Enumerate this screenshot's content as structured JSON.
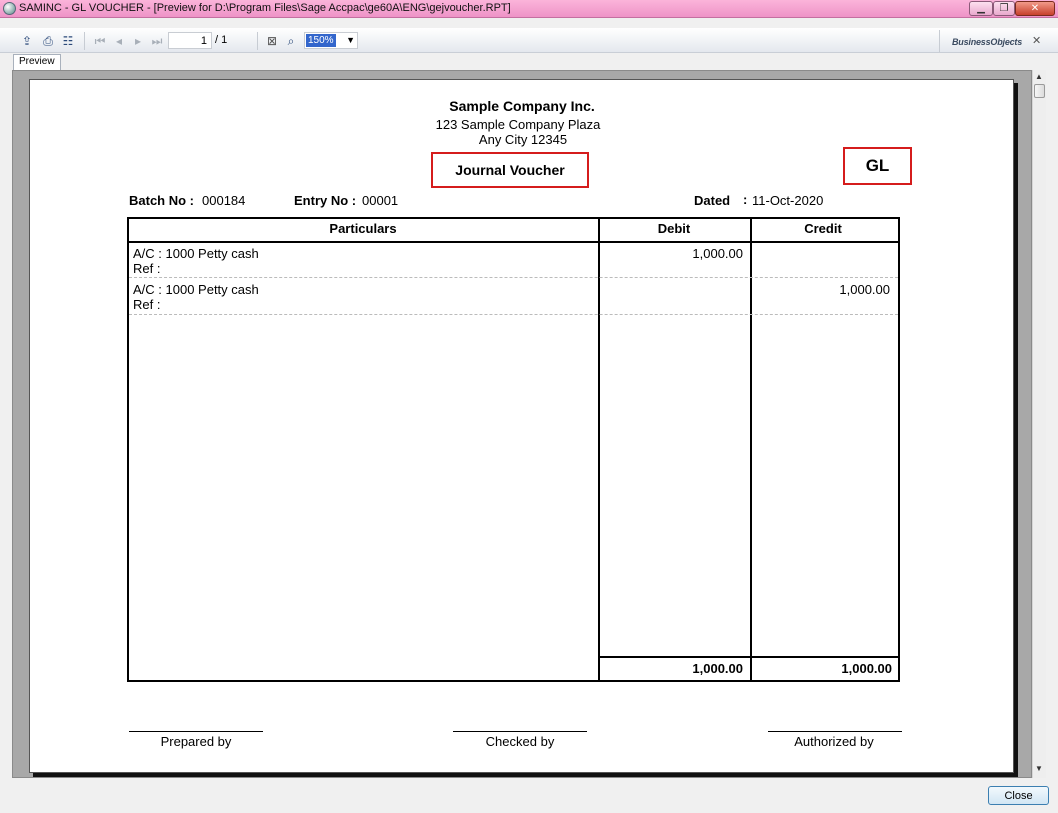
{
  "window": {
    "title": "SAMINC - GL VOUCHER - [Preview for D:\\Program Files\\Sage Accpac\\ge60A\\ENG\\gejvoucher.RPT]",
    "minimize_icon": "minimize-icon",
    "maximize_icon": "maximize-icon",
    "close_icon": "close-icon"
  },
  "toolbar": {
    "page_current": "1",
    "page_total": "/ 1",
    "zoom": "150%",
    "brand": "BusinessObjects",
    "icons": [
      "export-icon",
      "print-icon",
      "group-tree-icon",
      "first-page-icon",
      "prev-page-icon",
      "next-page-icon",
      "last-page-icon",
      "stop-icon",
      "find-icon",
      "dropdown-arrow-icon",
      "close-icon"
    ]
  },
  "tabs": [
    {
      "label": "Preview"
    }
  ],
  "report": {
    "company_name": "Sample Company Inc.",
    "address_line1": "123 Sample Company Plaza",
    "address_line2": "Any City 12345",
    "doc_title": "Journal Voucher",
    "ledger_code": "GL",
    "batch_label": "Batch No :",
    "batch_no": "000184",
    "entry_label": "Entry No :",
    "entry_no": "00001",
    "dated_label": "Dated",
    "dated_sep": ":",
    "date": "11-Oct-2020",
    "columns": {
      "particulars": "Particulars",
      "debit": "Debit",
      "credit": "Credit"
    },
    "rows": [
      {
        "account": "A/C : 1000 Petty cash",
        "ref": "Ref :",
        "debit": "1,000.00",
        "credit": ""
      },
      {
        "account": "A/C : 1000 Petty cash",
        "ref": "Ref :",
        "debit": "",
        "credit": "1,000.00"
      }
    ],
    "totals": {
      "debit": "1,000.00",
      "credit": "1,000.00"
    },
    "signatures": {
      "prepared": "Prepared by",
      "checked": "Checked by",
      "authorized": "Authorized by"
    }
  },
  "buttons": {
    "close": "Close"
  }
}
